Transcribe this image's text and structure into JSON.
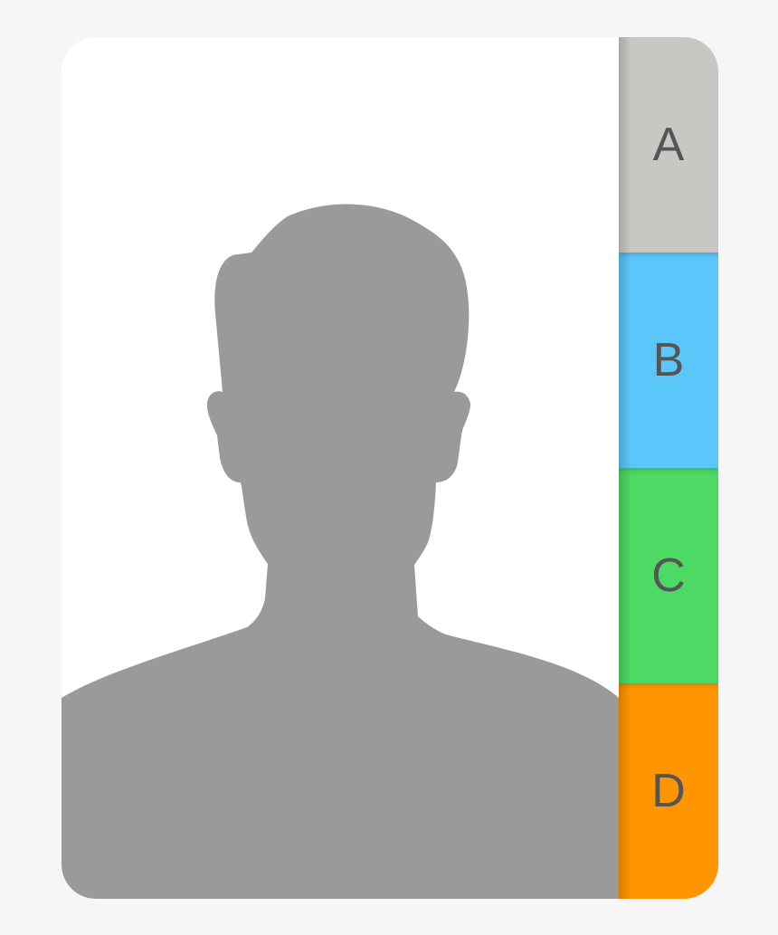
{
  "contact_card": {
    "avatar_icon": "person-silhouette-icon",
    "colors": {
      "background": "#f6f6f6",
      "card": "#ffffff",
      "silhouette": "#9a9a9a"
    },
    "tabs": [
      {
        "label": "A",
        "color": "#c8c7c3"
      },
      {
        "label": "B",
        "color": "#5ac6fa"
      },
      {
        "label": "C",
        "color": "#4cd964"
      },
      {
        "label": "D",
        "color": "#ff9500"
      }
    ]
  }
}
